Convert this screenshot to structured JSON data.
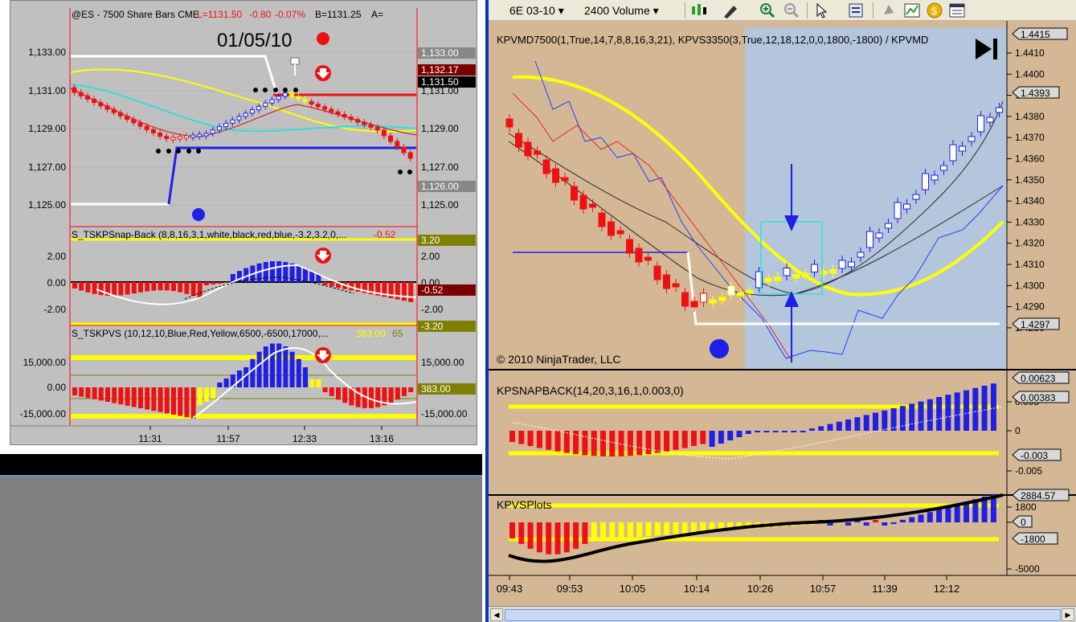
{
  "left": {
    "title_full": "@ES - 7500 Share Bars  CME",
    "quote_L": "L=1131.50",
    "quote_chg": "-0.80",
    "quote_pct": "-0.07%",
    "quote_B": "B=1131.25",
    "quote_more": "A=",
    "date_label": "01/05/10",
    "price_axis_left": [
      "1,133.00",
      "1,131.00",
      "1,129.00",
      "1,127.00",
      "1,125.00"
    ],
    "price_axis_right": [
      "1,133.00",
      "1,131.00",
      "1,129.00",
      "1,127.00",
      "1,125.00"
    ],
    "price_tags": {
      "t1": "1,132.17",
      "t2": "1,131.50",
      "t3": "1,126.00"
    },
    "snap_title": "S_TSKPSnap-Back (8,8,16,3,1,white,black,red,blue,-3.2,3.2,0,...",
    "snap_value": "-0.52",
    "snap_axis_left": [
      "2.00",
      "0.00",
      "-2.00"
    ],
    "snap_axis_right": [
      "2.00",
      "0.00",
      "-2.00"
    ],
    "snap_tags": {
      "top": "3.20",
      "val": "-0.52",
      "bot": "-3.20"
    },
    "pvs_title": "S_TSKPVS (10,12,10,Blue,Red,Yellow,6500,-6500,17000,...",
    "pvs_v1": "383.00",
    "pvs_v2": "65",
    "pvs_axis_left": [
      "15,000.00",
      "0.00",
      "-15,000.00"
    ],
    "pvs_axis_right": [
      "15,000.00",
      "0.00",
      "-15,000.00"
    ],
    "pvs_tag": "383.00",
    "time_labels": [
      "11:31",
      "11:57",
      "12:33",
      "13:16"
    ]
  },
  "right": {
    "toolbar": {
      "instrument": "6E 03-10",
      "period": "2400 Volume"
    },
    "main_title": "KPVMD7500(1,True,14,7,8,8,16,3,21), KPVS3350(3,True,12,18,12,0,0,1800,-1800) / KPVMD",
    "copyright": "© 2010 NinjaTrader, LLC",
    "price_axis": [
      "1.4410",
      "1.4400",
      "1.4390",
      "1.4380",
      "1.4370",
      "1.4360",
      "1.4350",
      "1.4340",
      "1.4330",
      "1.4320",
      "1.4310",
      "1.4300",
      "1.4290",
      "1.4280"
    ],
    "price_tags": {
      "t1": "1.4415",
      "t2": "1.4393",
      "t3": "1.4297"
    },
    "snap_title": "KPSNAPBACK(14,20,3,16,1,0.003,0)",
    "snap_axis": [
      "0.005",
      "0",
      "-0.005"
    ],
    "snap_tags": {
      "t1": "0.00623",
      "t2": "0.00383",
      "t3": "-0.003"
    },
    "pvs_title": "KPVSPlots",
    "pvs_axis": [
      "1800",
      "0",
      "-5000"
    ],
    "pvs_tags": {
      "t1": "2884.57",
      "t2": "0",
      "t3": "-1800"
    },
    "time_labels": [
      "09:43",
      "09:53",
      "10:05",
      "10:14",
      "10:26",
      "10:57",
      "11:39",
      "12:12"
    ]
  },
  "colors": {
    "left_bg": "#c0c0c0",
    "right_bg": "#d4b896",
    "right_highlight": "#b4c6dc",
    "bull": "#1f1fe6",
    "bear": "#ee1111",
    "yellow": "#ffff00",
    "cyan": "#33dddd",
    "frame_blue": "#0a34b8",
    "toolbar_bg": "#ece9d8"
  }
}
